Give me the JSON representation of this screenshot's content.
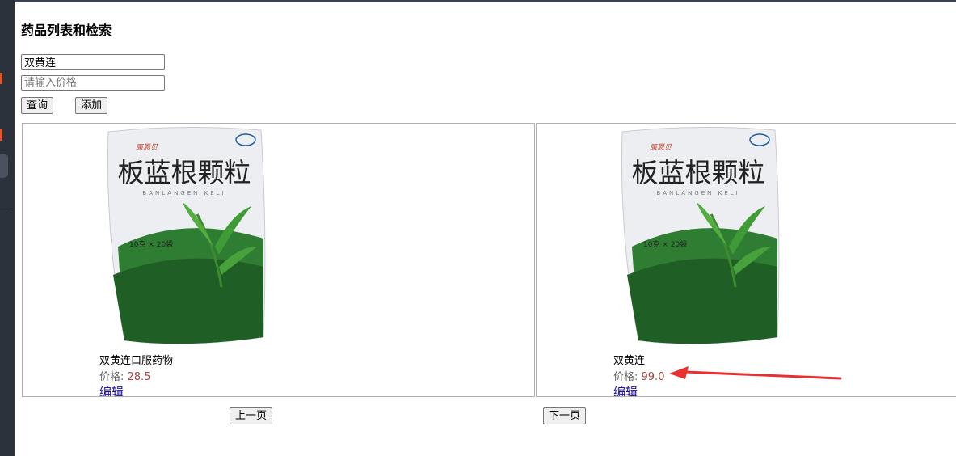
{
  "page": {
    "title": "药品列表和检索"
  },
  "search": {
    "name_value": "双黄连",
    "price_placeholder": "请输入价格",
    "query_label": "查询",
    "add_label": "添加"
  },
  "products": [
    {
      "name": "双黄连口服药物",
      "price_label": "价格: ",
      "price": "28.5",
      "edit_label": "编辑",
      "package": {
        "title": "板蓝根颗粒",
        "pinyin": "BANLANGEN KELI",
        "spec": "10克 × 20袋"
      }
    },
    {
      "name": "双黄连",
      "price_label": "价格: ",
      "price": "99.0",
      "edit_label": "编辑",
      "package": {
        "title": "板蓝根颗粒",
        "pinyin": "BANLANGEN KELI",
        "spec": "10克 × 20袋"
      }
    }
  ],
  "pagination": {
    "prev_label": "上一页",
    "next_label": "下一页"
  },
  "colors": {
    "price": "#a94442",
    "link": "#1a0dab",
    "annotation_arrow": "#e8312f",
    "package_green": "#2e7d32"
  }
}
